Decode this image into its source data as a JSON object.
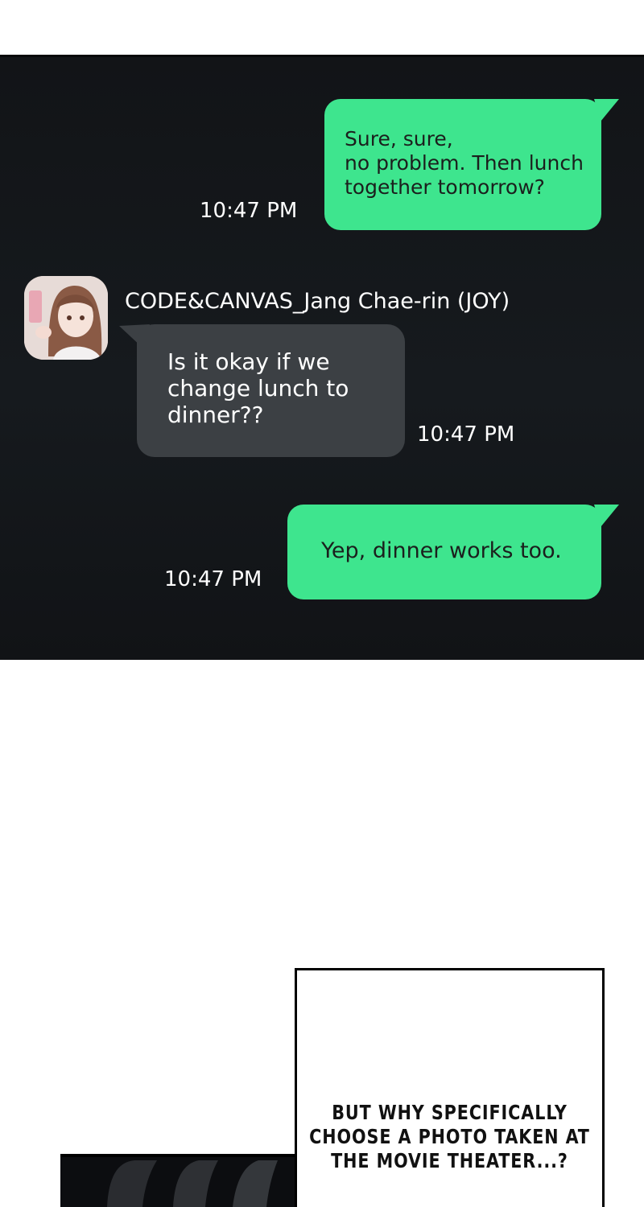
{
  "chat": {
    "messages": [
      {
        "direction": "outgoing",
        "text": "Sure, sure,\nno problem. Then lunch\ntogether tomorrow?",
        "time": "10:47 PM"
      },
      {
        "direction": "incoming",
        "sender": "CODE&CANVAS_Jang Chae-rin (JOY)",
        "text": "Is it okay if we\nchange lunch to\ndinner??",
        "time": "10:47 PM"
      },
      {
        "direction": "outgoing",
        "text": "Yep, dinner works too.",
        "time": "10:47 PM"
      }
    ],
    "colors": {
      "outgoing_bubble": "#3ee58e",
      "incoming_bubble": "#3c4044",
      "background": "#141719"
    }
  },
  "caption": {
    "text": "BUT WHY SPECIFICALLY\nCHOOSE A PHOTO TAKEN AT\nTHE MOVIE THEATER...?"
  }
}
